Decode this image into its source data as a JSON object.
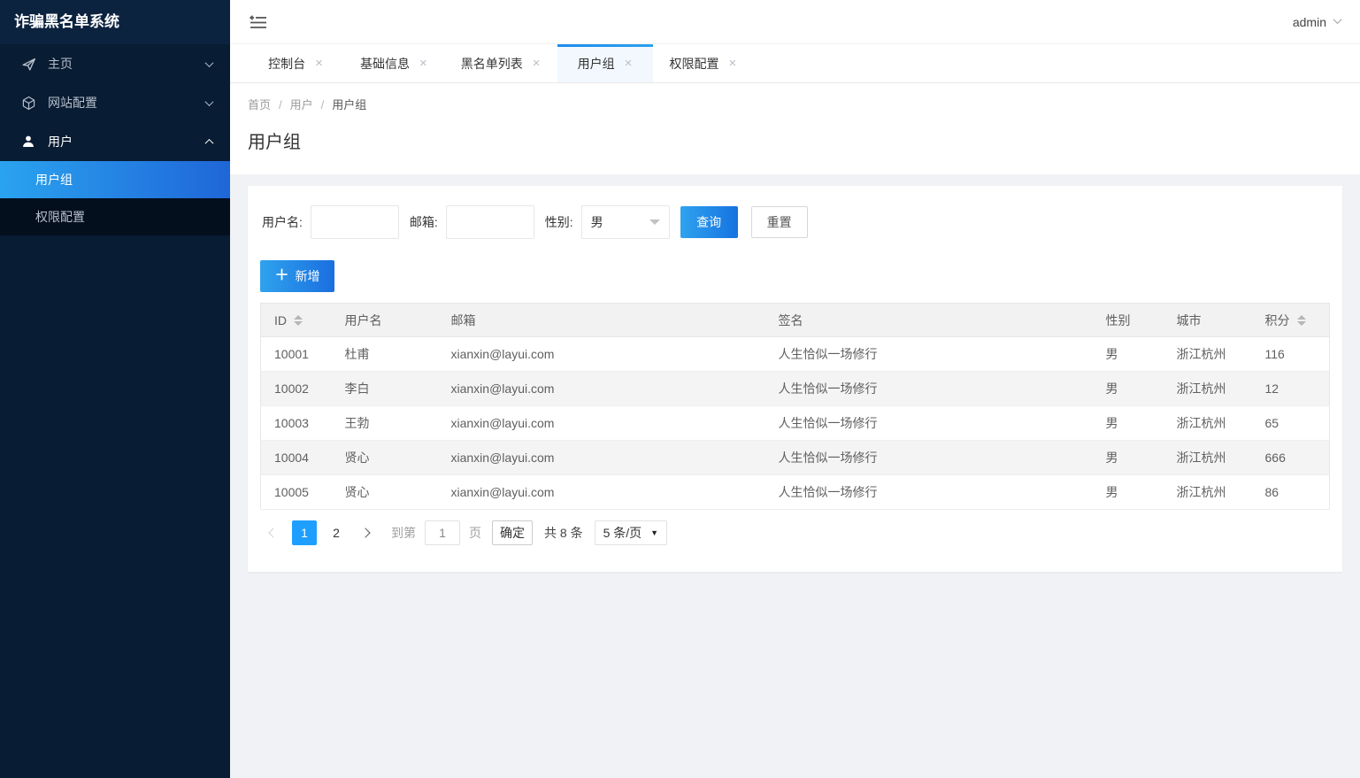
{
  "app": {
    "title": "诈骗黑名单系统",
    "user": "admin"
  },
  "sidebar": {
    "items": [
      {
        "label": "主页",
        "icon": "paper-plane-icon"
      },
      {
        "label": "网站配置",
        "icon": "cube-icon"
      },
      {
        "label": "用户",
        "icon": "user-icon",
        "children": [
          {
            "label": "用户组",
            "active": true
          },
          {
            "label": "权限配置",
            "active": false
          }
        ]
      }
    ]
  },
  "tabs": [
    {
      "label": "控制台"
    },
    {
      "label": "基础信息"
    },
    {
      "label": "黑名单列表"
    },
    {
      "label": "用户组",
      "active": true
    },
    {
      "label": "权限配置"
    }
  ],
  "breadcrumb": {
    "separator": "/",
    "items": [
      "首页",
      "用户",
      "用户组"
    ]
  },
  "page": {
    "title": "用户组"
  },
  "search": {
    "username_label": "用户名:",
    "email_label": "邮箱:",
    "gender_label": "性别:",
    "gender_value": "男",
    "query_label": "查询",
    "reset_label": "重置"
  },
  "toolbar": {
    "add_label": "新增",
    "add_icon": "＋"
  },
  "table": {
    "columns": {
      "id": "ID",
      "username": "用户名",
      "email": "邮箱",
      "sign": "签名",
      "sex": "性别",
      "city": "城市",
      "score": "积分"
    },
    "rows": [
      {
        "id": "10001",
        "username": "杜甫",
        "email": "xianxin@layui.com",
        "sign": "人生恰似一场修行",
        "sex": "男",
        "city": "浙江杭州",
        "score": "116"
      },
      {
        "id": "10002",
        "username": "李白",
        "email": "xianxin@layui.com",
        "sign": "人生恰似一场修行",
        "sex": "男",
        "city": "浙江杭州",
        "score": "12"
      },
      {
        "id": "10003",
        "username": "王勃",
        "email": "xianxin@layui.com",
        "sign": "人生恰似一场修行",
        "sex": "男",
        "city": "浙江杭州",
        "score": "65"
      },
      {
        "id": "10004",
        "username": "贤心",
        "email": "xianxin@layui.com",
        "sign": "人生恰似一场修行",
        "sex": "男",
        "city": "浙江杭州",
        "score": "666"
      },
      {
        "id": "10005",
        "username": "贤心",
        "email": "xianxin@layui.com",
        "sign": "人生恰似一场修行",
        "sex": "男",
        "city": "浙江杭州",
        "score": "86"
      }
    ]
  },
  "pagination": {
    "pages": [
      "1",
      "2"
    ],
    "active_page": "1",
    "goto_prefix": "到第",
    "goto_value": "1",
    "goto_suffix": "页",
    "confirm_label": "确定",
    "total_text": "共 8 条",
    "page_size": "5 条/页"
  },
  "colors": {
    "accent": "#1E9FFF",
    "sidebar_bg": "#081c33",
    "sidebar_header_bg": "#0c2340",
    "active_gradient_start": "#2aa3ef",
    "active_gradient_end": "#1f66d8"
  }
}
